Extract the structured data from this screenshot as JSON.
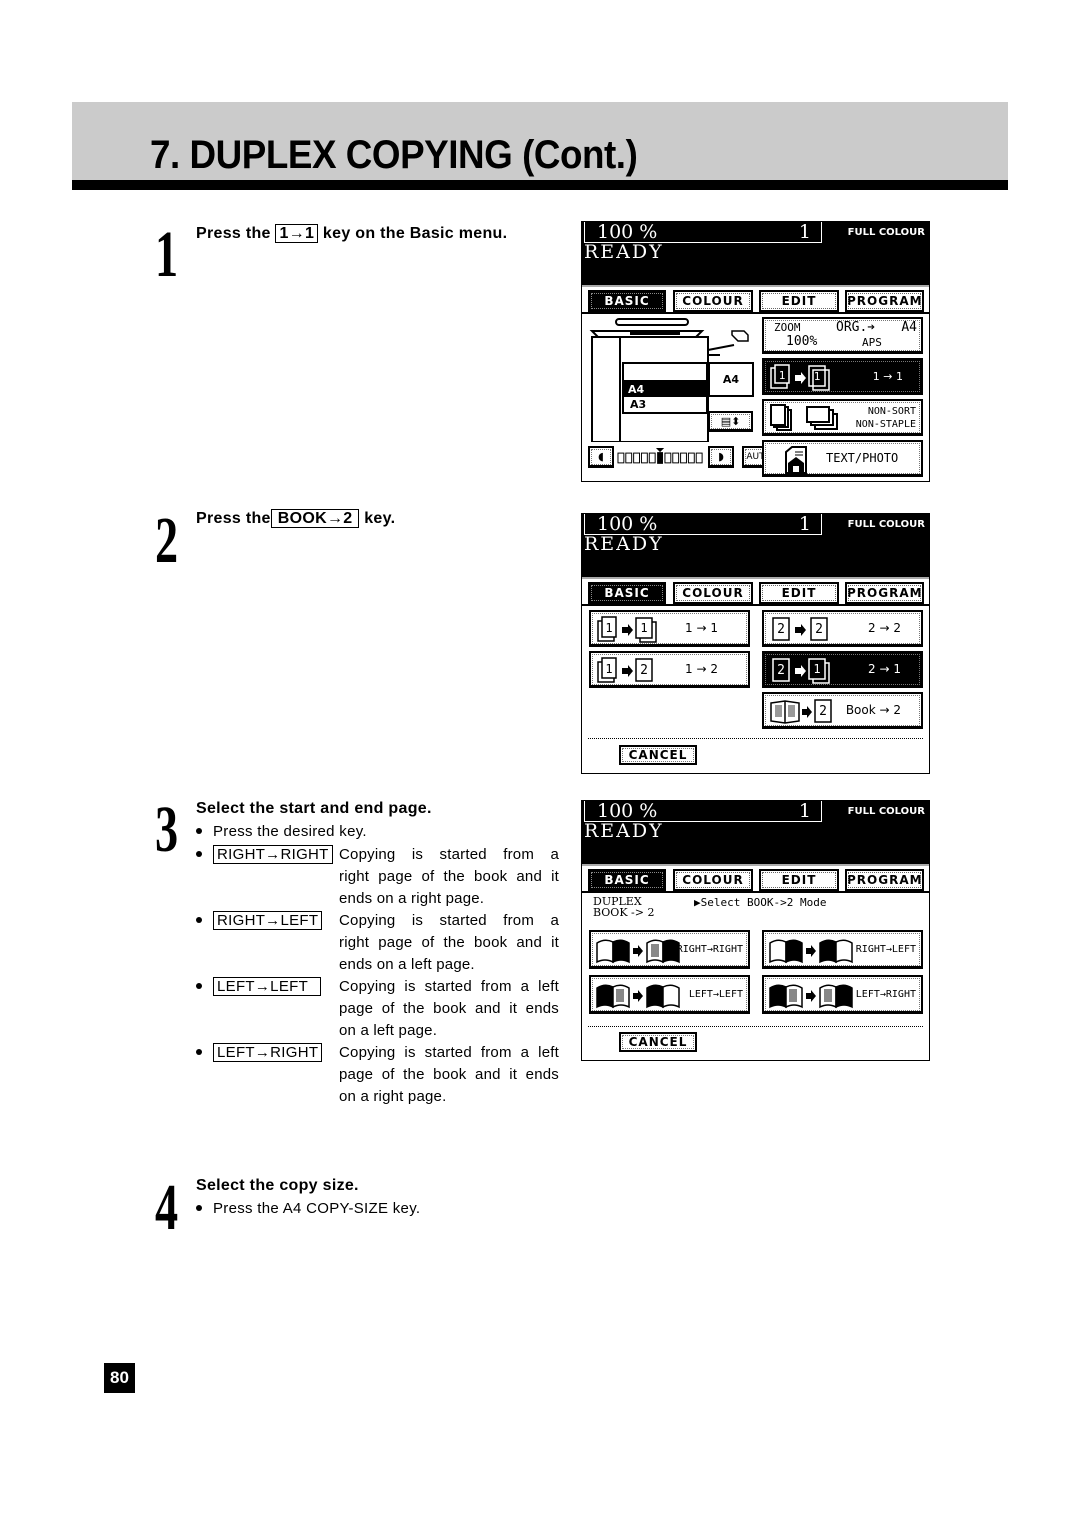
{
  "page": {
    "title": "7. DUPLEX COPYING (Cont.)",
    "page_number": "80"
  },
  "steps": [
    {
      "number": "1",
      "pre": "Press the ",
      "key": "1→1",
      "post": " key on the Basic menu."
    },
    {
      "number": "2",
      "pre": "Press the",
      "key": "BOOK→2",
      "post": " key."
    },
    {
      "number": "3",
      "heading": "Select the start and end page.",
      "bullets": [
        {
          "text": "Press the desired key."
        },
        {
          "key": "RIGHT→RIGHT",
          "desc": [
            "Copying is started from a",
            "right page of the book and it",
            "ends on a right page."
          ]
        },
        {
          "key": "RIGHT→LEFT",
          "desc": [
            "Copying is started from a",
            "right page of the book and it",
            "ends on a left page."
          ]
        },
        {
          "key": "LEFT→LEFT",
          "desc": [
            "Copying is started from a left",
            "page of the book and it ends",
            "on a left page."
          ]
        },
        {
          "key": "LEFT→RIGHT",
          "desc": [
            "Copying is started from a left",
            "page of the book and it ends",
            "on a right page."
          ]
        }
      ]
    },
    {
      "number": "4",
      "heading": "Select the copy size.",
      "bullets": [
        {
          "text": "Press the A4 COPY-SIZE key."
        }
      ]
    }
  ],
  "panel_common": {
    "zoom": "100 %",
    "count": "1",
    "colour_mode": "FULL COLOUR",
    "status": "READY",
    "tabs": [
      "BASIC",
      "COLOUR",
      "EDIT",
      "PROGRAM"
    ],
    "active_tab": "BASIC",
    "cancel": "CANCEL"
  },
  "panel1": {
    "zoom_label": "ZOOM",
    "zoom_value": "100%",
    "org_label": "ORG.➔",
    "org_size": "A4",
    "aps": "APS",
    "tray_sizes": [
      "A4",
      "A3"
    ],
    "selected_tray": "A4",
    "bypass_size": "A4",
    "duplex_label": "1 → 1",
    "sort_line1": "NON-SORT",
    "sort_line2": "NON-STAPLE",
    "density_auto": "AUTO",
    "original_mode": "TEXT/PHOTO"
  },
  "panel2": {
    "modes": [
      {
        "label": "1 → 1",
        "active": false
      },
      {
        "label": "2 → 2",
        "active": false
      },
      {
        "label": "1 → 2",
        "active": false
      },
      {
        "label": "2 → 1",
        "active": true
      },
      {
        "label": "Book → 2",
        "active": false
      }
    ]
  },
  "panel3": {
    "mode_line1": "DUPLEX",
    "mode_line2": "BOOK -> 2",
    "prompt": "▶Select BOOK->2 Mode",
    "options": [
      "RIGHT→RIGHT",
      "RIGHT→LEFT",
      "LEFT→LEFT",
      "LEFT→RIGHT"
    ]
  }
}
